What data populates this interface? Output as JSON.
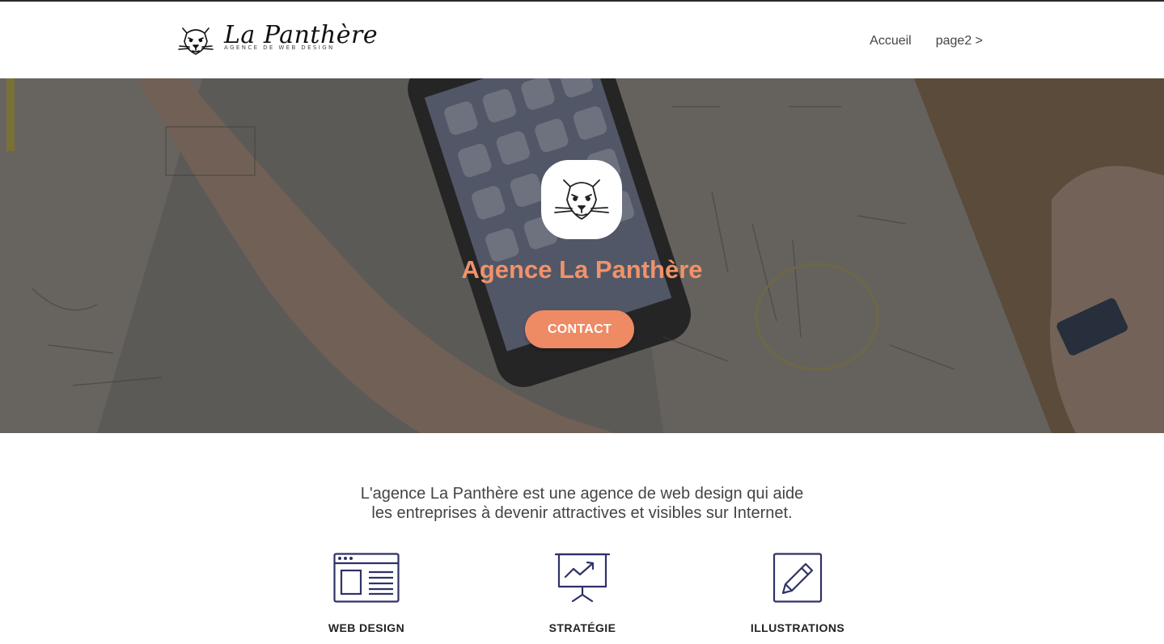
{
  "header": {
    "logo_title": "La Panthère",
    "logo_subtitle": "AGENCE DE WEB DESIGN",
    "nav": [
      {
        "label": "Accueil"
      },
      {
        "label": "page2 >"
      }
    ]
  },
  "hero": {
    "title": "Agence La Panthère",
    "button_label": "CONTACT"
  },
  "intro": {
    "line1": "L'agence La Panthère est une agence de web design qui aide",
    "line2": "les entreprises à devenir attractives et visibles sur Internet."
  },
  "services": [
    {
      "label": "WEB DESIGN",
      "icon": "web-design-icon"
    },
    {
      "label": "STRATÉGIE",
      "icon": "strategy-chart-icon"
    },
    {
      "label": "ILLUSTRATIONS",
      "icon": "pencil-illustration-icon"
    }
  ],
  "colors": {
    "accent": "#ee8a64",
    "hero_title": "#f0926a",
    "icon_stroke": "#2e3266"
  }
}
